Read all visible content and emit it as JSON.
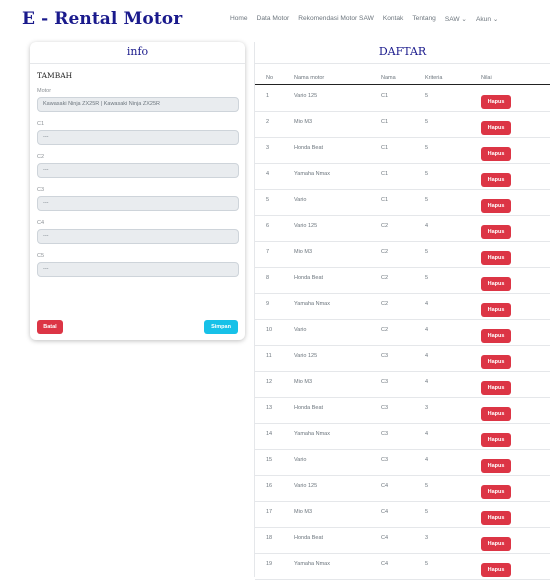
{
  "navbar": {
    "brand": "E - Rental Motor",
    "links": [
      "Home",
      "Data Motor",
      "Rekomendasi Motor SAW",
      "Kontak",
      "Tentang",
      "SAW ⌄",
      "Akun ⌄"
    ]
  },
  "info": {
    "title": "info",
    "section": "TAMBAH",
    "motor_label": "Motor",
    "motor_value": "Kawasaki Ninja ZX25R | Kawasaki Ninja ZX25R",
    "fields": [
      {
        "label": "C1",
        "value": "---"
      },
      {
        "label": "C2",
        "value": "---"
      },
      {
        "label": "C3",
        "value": "---"
      },
      {
        "label": "C4",
        "value": "---"
      },
      {
        "label": "C5",
        "value": "---"
      }
    ],
    "batal_label": "Batal",
    "simpan_label": "Simpan"
  },
  "daftar": {
    "title": "DAFTAR",
    "columns": [
      "No",
      "Nama motor",
      "Nama",
      "Kriteria",
      "Nilai"
    ],
    "action_label": "Hapus",
    "rows": [
      [
        "1",
        "Vario 125",
        "C1",
        "5"
      ],
      [
        "2",
        "Mio M3",
        "C1",
        "5"
      ],
      [
        "3",
        "Honda Beat",
        "C1",
        "5"
      ],
      [
        "4",
        "Yamaha Nmax",
        "C1",
        "5"
      ],
      [
        "5",
        "Vario",
        "C1",
        "5"
      ],
      [
        "6",
        "Vario 125",
        "C2",
        "4"
      ],
      [
        "7",
        "Mio M3",
        "C2",
        "5"
      ],
      [
        "8",
        "Honda Beat",
        "C2",
        "5"
      ],
      [
        "9",
        "Yamaha Nmax",
        "C2",
        "4"
      ],
      [
        "10",
        "Vario",
        "C2",
        "4"
      ],
      [
        "11",
        "Vario 125",
        "C3",
        "4"
      ],
      [
        "12",
        "Mio M3",
        "C3",
        "4"
      ],
      [
        "13",
        "Honda Beat",
        "C3",
        "3"
      ],
      [
        "14",
        "Yamaha Nmax",
        "C3",
        "4"
      ],
      [
        "15",
        "Vario",
        "C3",
        "4"
      ],
      [
        "16",
        "Vario 125",
        "C4",
        "5"
      ],
      [
        "17",
        "Mio M3",
        "C4",
        "5"
      ],
      [
        "18",
        "Honda Beat",
        "C4",
        "3"
      ],
      [
        "19",
        "Yamaha Nmax",
        "C4",
        "5"
      ]
    ]
  }
}
